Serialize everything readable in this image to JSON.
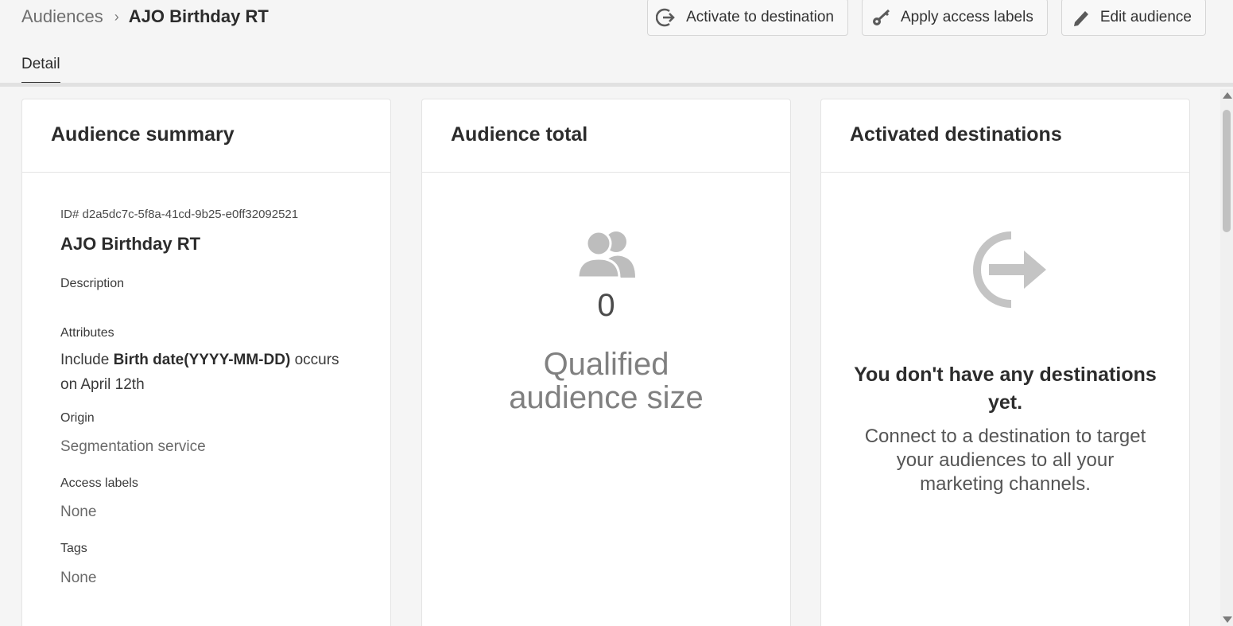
{
  "breadcrumb": {
    "parent": "Audiences",
    "separator": "›",
    "current": "AJO Birthday RT"
  },
  "actions": {
    "activate": "Activate to destination",
    "apply_labels": "Apply access labels",
    "edit": "Edit audience"
  },
  "tabs": [
    {
      "label": "Detail",
      "active": true
    }
  ],
  "summary": {
    "heading": "Audience summary",
    "id": "ID# d2a5dc7c-5f8a-41cd-9b25-e0ff32092521",
    "name": "AJO Birthday RT",
    "description_label": "Description",
    "attributes_label": "Attributes",
    "attr_prefix": "Include",
    "attr_field": "Birth date(YYYY-MM-DD)",
    "attr_rest": "occurs on April 12th",
    "origin_label": "Origin",
    "origin_value": "Segmentation service",
    "access_labels_label": "Access labels",
    "access_labels_value": "None",
    "tags_label": "Tags",
    "tags_value": "None"
  },
  "total": {
    "heading": "Audience total",
    "count": "0",
    "caption": "Qualified audience size",
    "icon": "user-group-icon"
  },
  "destinations": {
    "heading": "Activated destinations",
    "empty_title": "You don't have any destinations yet.",
    "empty_desc": "Connect to a destination to target your audiences to all your marketing channels.",
    "icon": "export-arrow-icon"
  },
  "colors": {
    "icon_gray": "#bdbdbd",
    "page_bg": "#f5f5f5",
    "card_bg": "#ffffff"
  }
}
